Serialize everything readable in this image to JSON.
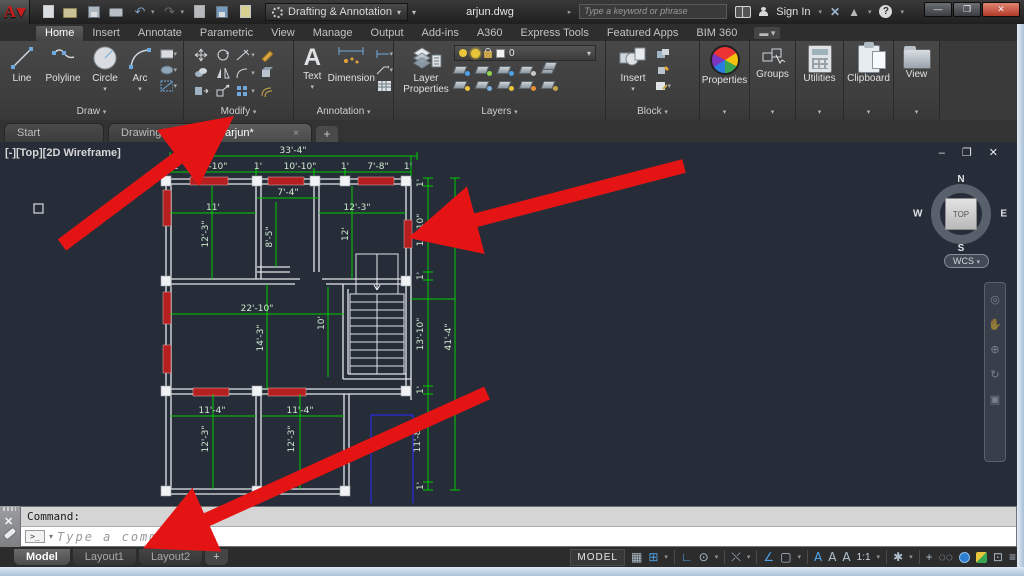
{
  "titlebar": {
    "app_initial": "A",
    "workspace": "Drafting & Annotation",
    "title": "arjun.dwg",
    "search_placeholder": "Type a keyword or phrase",
    "sign_in": "Sign In",
    "help": "?"
  },
  "ribbon": {
    "tabs": [
      {
        "label": "Home"
      },
      {
        "label": "Insert"
      },
      {
        "label": "Annotate"
      },
      {
        "label": "Parametric"
      },
      {
        "label": "View"
      },
      {
        "label": "Manage"
      },
      {
        "label": "Output"
      },
      {
        "label": "Add-ins"
      },
      {
        "label": "A360"
      },
      {
        "label": "Express Tools"
      },
      {
        "label": "Featured Apps"
      },
      {
        "label": "BIM 360"
      }
    ],
    "draw": {
      "label": "Draw",
      "line": "Line",
      "polyline": "Polyline",
      "circle": "Circle",
      "arc": "Arc"
    },
    "modify": {
      "label": "Modify"
    },
    "annotation": {
      "label": "Annotation",
      "text": "Text",
      "dimension": "Dimension",
      "text_glyph": "A"
    },
    "layers": {
      "label": "Layers",
      "layer_properties_1": "Layer",
      "layer_properties_2": "Properties",
      "current_layer": "0"
    },
    "block": {
      "label": "Block",
      "insert": "Insert"
    },
    "properties": {
      "label": "Properties"
    },
    "groups": {
      "label": "Groups"
    },
    "utilities": {
      "label": "Utilities"
    },
    "clipboard": {
      "label": "Clipboard"
    },
    "view": {
      "label": "View"
    }
  },
  "file_tabs": {
    "start": "Start",
    "drawing1": "Drawing1",
    "arjun": "arjun*",
    "add": "+",
    "close_glyph": "×"
  },
  "viewport": {
    "label": "[-][Top][2D Wireframe]",
    "winbtns": "– ❐ ✕",
    "viewcube": {
      "n": "N",
      "s": "S",
      "e": "E",
      "w": "W",
      "top": "TOP",
      "wcs": "WCS"
    }
  },
  "drawing": {
    "dims": {
      "total_width": "33'-4\"",
      "t1": "1'",
      "t2": "10'-10\"",
      "t3": "1'",
      "t4": "10'-10\"",
      "t5": "1'",
      "t6": "7'-8\"",
      "t7": "1'",
      "room_tl_w": "11'",
      "room_tl_h": "12'-3\"",
      "hall_w": "7'-4\"",
      "hall_h": "8'-5\"",
      "room_tr_w": "12'-3\"",
      "room_tr_h": "12'",
      "mid_w": "22'-10\"",
      "mid_h": "14'-3\"",
      "stair_w": "10'",
      "room_bl_w": "11'-4\"",
      "room_bl_h": "12'-3\"",
      "room_bm_w": "11'-4\"",
      "room_bm_h": "12'-3\"",
      "r1": "1'",
      "r2": "11'-10\"",
      "r3": "1'",
      "r4": "13'-10\"",
      "r5": "1'",
      "r6": "11'-8\"",
      "r7": "1'",
      "total_height": "41'-4\""
    },
    "colors": {
      "dim_green": "#00cc00",
      "dim_text": "#cfe9cf",
      "wall_white": "#e3e7ea",
      "hatch_red": "#b51f1f",
      "select_blue": "#2a2ae0",
      "arrow_red": "#e51414"
    }
  },
  "command": {
    "history": "Command:",
    "prompt_glyph": ">_",
    "placeholder": "Type a command"
  },
  "statusbar": {
    "model_tab": "Model",
    "layout1_tab": "Layout1",
    "layout2_tab": "Layout2",
    "add_layout": "+",
    "model_space": "MODEL",
    "annotation_scale": "1:1"
  }
}
